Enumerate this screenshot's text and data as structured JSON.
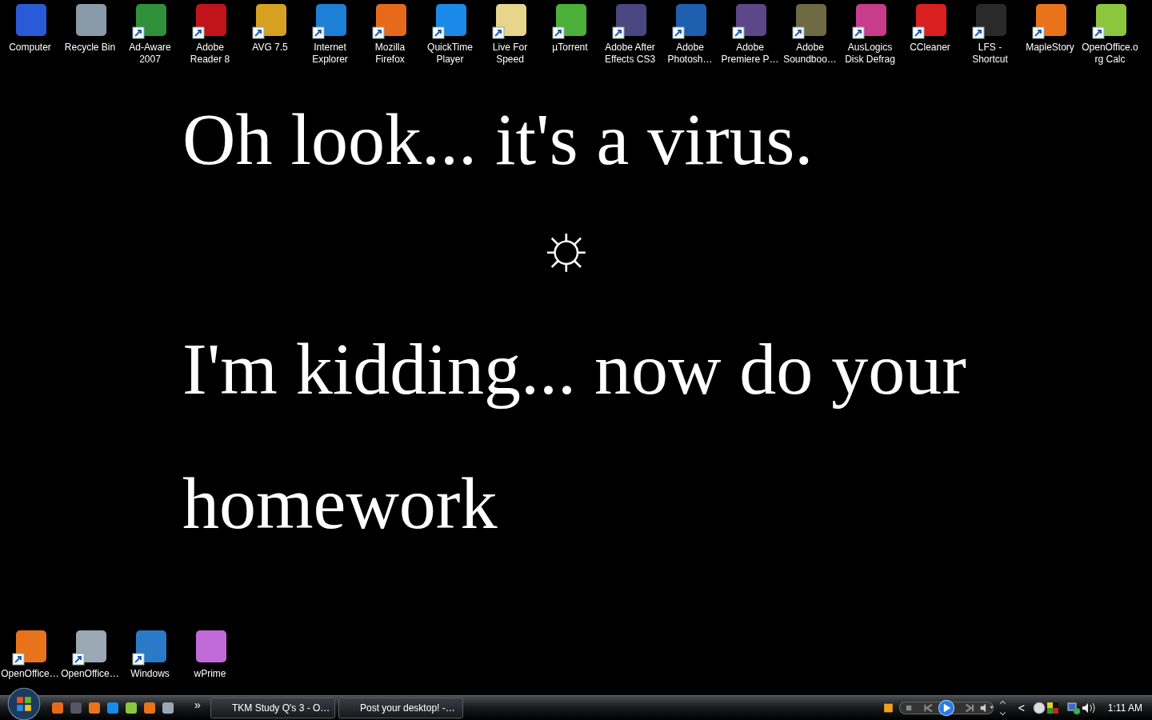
{
  "desktop_icons_top": [
    {
      "lines": [
        "Computer"
      ],
      "color": "#2a5bd7",
      "shortcut": false
    },
    {
      "lines": [
        "Recycle Bin"
      ],
      "color": "#8a9aa8",
      "shortcut": false
    },
    {
      "lines": [
        "Ad-Aware",
        "2007"
      ],
      "color": "#2f8f3a",
      "shortcut": true
    },
    {
      "lines": [
        "Adobe",
        "Reader 8"
      ],
      "color": "#c0141a",
      "shortcut": true
    },
    {
      "lines": [
        "AVG 7.5"
      ],
      "color": "#d8a020",
      "shortcut": true
    },
    {
      "lines": [
        "Internet",
        "Explorer"
      ],
      "color": "#1e7fd6",
      "shortcut": true
    },
    {
      "lines": [
        "Mozilla",
        "Firefox"
      ],
      "color": "#e66a1a",
      "shortcut": true
    },
    {
      "lines": [
        "QuickTime",
        "Player"
      ],
      "color": "#1a8ae8",
      "shortcut": true
    },
    {
      "lines": [
        "Live For",
        "Speed"
      ],
      "color": "#e8d48a",
      "shortcut": true
    },
    {
      "lines": [
        "µTorrent"
      ],
      "color": "#4caf3a",
      "shortcut": true
    },
    {
      "lines": [
        "Adobe After",
        "Effects CS3"
      ],
      "color": "#4a4682",
      "shortcut": true
    },
    {
      "lines": [
        "Adobe",
        "Photosh…"
      ],
      "color": "#1f5fb0",
      "shortcut": true
    },
    {
      "lines": [
        "Adobe",
        "Premiere P…"
      ],
      "color": "#5c4788",
      "shortcut": true
    },
    {
      "lines": [
        "Adobe",
        "Soundboo…"
      ],
      "color": "#6e6a44",
      "shortcut": true
    },
    {
      "lines": [
        "AusLogics",
        "Disk Defrag"
      ],
      "color": "#c83c8c",
      "shortcut": true
    },
    {
      "lines": [
        "CCleaner"
      ],
      "color": "#d82020",
      "shortcut": true
    },
    {
      "lines": [
        "LFS -",
        "Shortcut"
      ],
      "color": "#2a2a2a",
      "shortcut": true
    },
    {
      "lines": [
        "MapleStory"
      ],
      "color": "#e8731a",
      "shortcut": true
    },
    {
      "lines": [
        "OpenOffice.o",
        "rg Calc"
      ],
      "color": "#8cc63e",
      "shortcut": true
    }
  ],
  "wallpaper": {
    "line_1": "Oh look... it's a virus.",
    "symbol": "☼",
    "line_2": "I'm kidding... now do your homework"
  },
  "desktop_icons_bottom": [
    {
      "lines": [
        "OpenOffice…"
      ],
      "color": "#e8731a",
      "shortcut": true
    },
    {
      "lines": [
        "OpenOffice…"
      ],
      "color": "#9aa8b4",
      "shortcut": true
    },
    {
      "lines": [
        "Windows"
      ],
      "color": "#2a7ac8",
      "shortcut": true
    },
    {
      "lines": [
        "wPrime"
      ],
      "color": "#c06ad8",
      "shortcut": false
    }
  ],
  "taskbar": {
    "quick_launch_more": "»",
    "tasks": [
      {
        "label": "TKM Study Q's 3 - O…",
        "selected": false
      },
      {
        "label": "Post your desktop! -…",
        "selected": false
      }
    ],
    "tray_chevron": "<",
    "clock": "1:11 AM"
  }
}
